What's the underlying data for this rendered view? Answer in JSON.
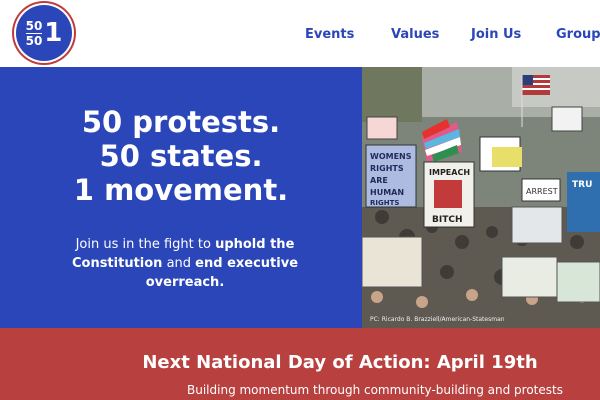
{
  "logo": {
    "top": "50",
    "bottom": "50",
    "number": "1",
    "colors": {
      "fill": "#2b46b8",
      "ring": "#c23a3a"
    }
  },
  "nav": {
    "items": [
      "Events",
      "Values",
      "Join Us",
      "Groups"
    ]
  },
  "hero": {
    "headline_lines": [
      "50 protests.",
      "50 states.",
      "1 movement."
    ],
    "subtext": {
      "part1": "Join us in the fight to ",
      "bold1": "uphold the Constitution",
      "part2": " and ",
      "bold2": "end executive overreach."
    },
    "photo_credit": "PC: Ricardo B. Brazziell/American-Statesman",
    "photo_signs": [
      "WOMENS RIGHTS ARE HUMAN RIGHTS",
      "IMPEACH THE BITCH",
      "ARREST",
      "TRU"
    ]
  },
  "banner": {
    "title": "Next National Day of Action: April 19th",
    "subtitle": "Building momentum through community-building and protests"
  },
  "colors": {
    "primary_blue": "#2b46b8",
    "banner_red": "#b8403f",
    "white": "#ffffff"
  }
}
